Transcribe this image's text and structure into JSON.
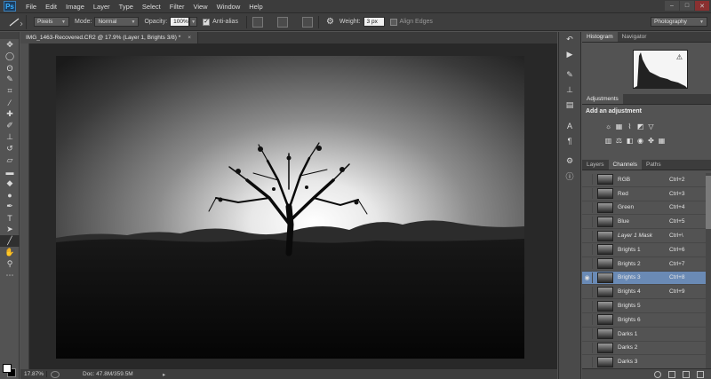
{
  "app": {
    "logo": "Ps"
  },
  "menu": [
    "File",
    "Edit",
    "Image",
    "Layer",
    "Type",
    "Select",
    "Filter",
    "View",
    "Window",
    "Help"
  ],
  "window_controls": {
    "min": "–",
    "max": "□",
    "close": "✕"
  },
  "options": {
    "shape_mode": "Pixels",
    "mode_label": "Mode:",
    "mode_value": "Normal",
    "opacity_label": "Opacity:",
    "opacity_value": "100%",
    "antialias_label": "Anti-alias",
    "weight_label": "Weight:",
    "weight_value": "3 px",
    "align_edges_label": "Align Edges",
    "workspace": "Photography"
  },
  "document": {
    "tab_title": "IMG_1463-Recovered.CR2 @ 17.9% (Layer 1, Brights 3/8) *",
    "close": "×"
  },
  "status": {
    "zoom": "17.87%",
    "doc": "Doc: 47.8M/359.5M",
    "arrow": "▸"
  },
  "panels": {
    "top_tabs": [
      "Histogram",
      "Navigator"
    ],
    "adjustments_tab": "Adjustments",
    "add_adjustment": "Add an adjustment",
    "channel_tabs": [
      "Layers",
      "Channels",
      "Paths"
    ],
    "channels": [
      {
        "name": "RGB",
        "key": "Ctrl+2",
        "italic": false,
        "selected": false,
        "visible": false
      },
      {
        "name": "Red",
        "key": "Ctrl+3",
        "italic": false,
        "selected": false,
        "visible": false
      },
      {
        "name": "Green",
        "key": "Ctrl+4",
        "italic": false,
        "selected": false,
        "visible": false
      },
      {
        "name": "Blue",
        "key": "Ctrl+5",
        "italic": false,
        "selected": false,
        "visible": false
      },
      {
        "name": "Layer 1 Mask",
        "key": "Ctrl+\\",
        "italic": true,
        "selected": false,
        "visible": false
      },
      {
        "name": "Brights 1",
        "key": "Ctrl+6",
        "italic": false,
        "selected": false,
        "visible": false
      },
      {
        "name": "Brights 2",
        "key": "Ctrl+7",
        "italic": false,
        "selected": false,
        "visible": false
      },
      {
        "name": "Brights 3",
        "key": "Ctrl+8",
        "italic": false,
        "selected": true,
        "visible": true
      },
      {
        "name": "Brights 4",
        "key": "Ctrl+9",
        "italic": false,
        "selected": false,
        "visible": false
      },
      {
        "name": "Brights 5",
        "key": "",
        "italic": false,
        "selected": false,
        "visible": false
      },
      {
        "name": "Brights 6",
        "key": "",
        "italic": false,
        "selected": false,
        "visible": false
      },
      {
        "name": "Darks 1",
        "key": "",
        "italic": false,
        "selected": false,
        "visible": false
      },
      {
        "name": "Darks 2",
        "key": "",
        "italic": false,
        "selected": false,
        "visible": false
      },
      {
        "name": "Darks 3",
        "key": "",
        "italic": false,
        "selected": false,
        "visible": false
      }
    ]
  },
  "colors": {
    "selection": "#6a8ab5",
    "chrome": "#535353",
    "dark": "#282828"
  }
}
